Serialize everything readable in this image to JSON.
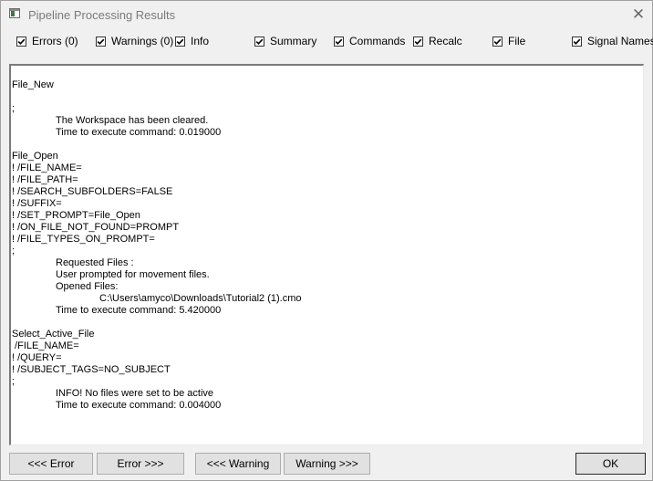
{
  "window": {
    "title": "Pipeline Processing Results",
    "close_glyph": "✕"
  },
  "filters": [
    {
      "label": "Errors (0)",
      "checked": true
    },
    {
      "label": "Warnings (0)",
      "checked": true
    },
    {
      "label": "Info",
      "checked": true
    },
    {
      "label": "Summary",
      "checked": true
    },
    {
      "label": "Commands",
      "checked": true
    },
    {
      "label": "Recalc",
      "checked": true
    },
    {
      "label": "File",
      "checked": true
    },
    {
      "label": "Signal Names",
      "checked": true
    }
  ],
  "log": [
    "File_New",
    "",
    ";",
    "    The Workspace has been cleared.",
    "    Time to execute command: 0.019000",
    "",
    "File_Open",
    "! /FILE_NAME=",
    "! /FILE_PATH=",
    "! /SEARCH_SUBFOLDERS=FALSE",
    "! /SUFFIX=",
    "! /SET_PROMPT=File_Open",
    "! /ON_FILE_NOT_FOUND=PROMPT",
    "! /FILE_TYPES_ON_PROMPT=",
    ";",
    "    Requested Files :",
    "    User prompted for movement files.",
    "    Opened Files:",
    "        C:\\Users\\amyco\\Downloads\\Tutorial2 (1).cmo",
    "    Time to execute command: 5.420000",
    "",
    "Select_Active_File",
    " /FILE_NAME=",
    "! /QUERY=",
    "! /SUBJECT_TAGS=NO_SUBJECT",
    ";",
    "    INFO! No files were set to be active",
    "    Time to execute command: 0.004000"
  ],
  "buttons": {
    "prev_error": "<<< Error",
    "next_error": "Error >>>",
    "prev_warning": "<<< Warning",
    "next_warning": "Warning >>>",
    "ok": "OK"
  }
}
